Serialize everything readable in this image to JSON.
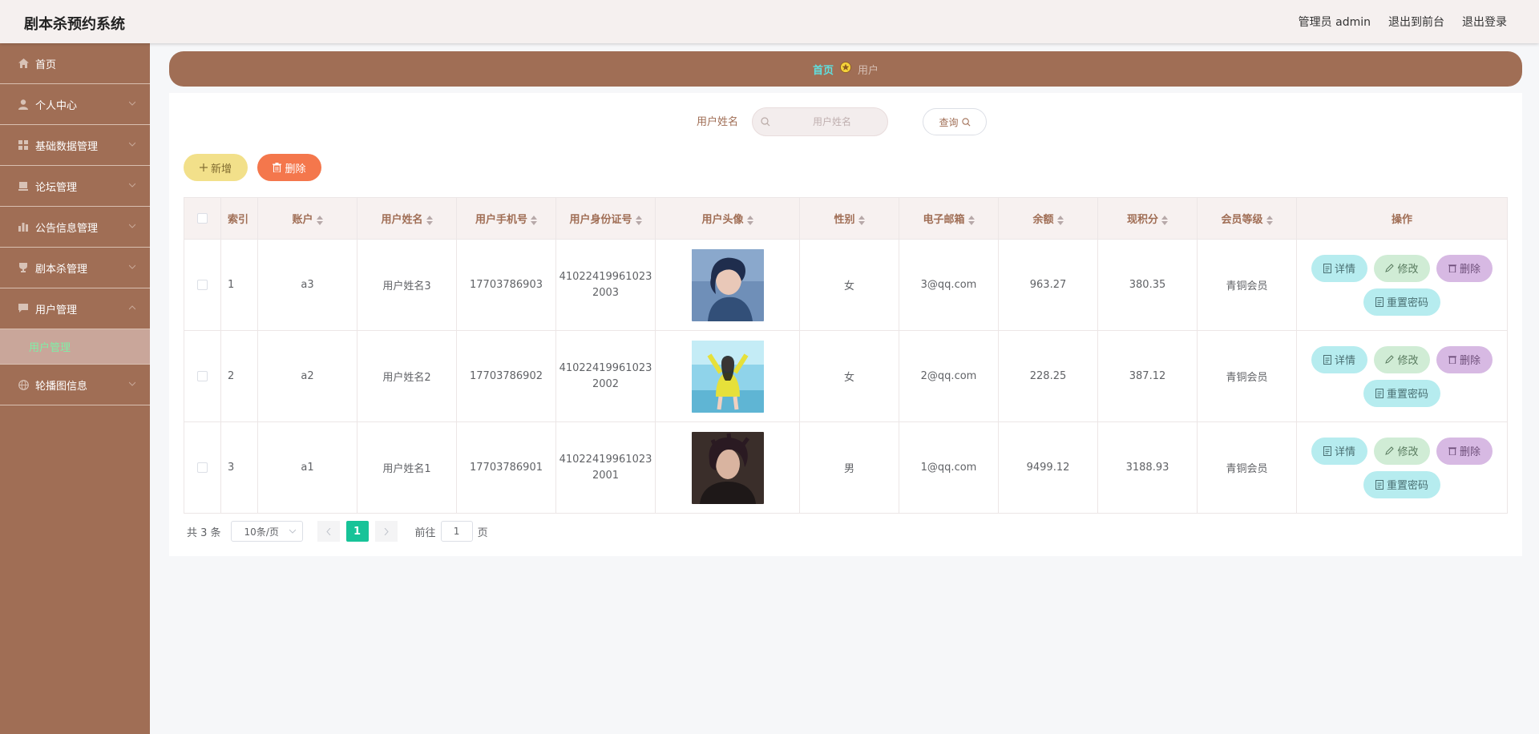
{
  "app": {
    "title": "剧本杀预约系统"
  },
  "topnav": {
    "admin": "管理员 admin",
    "front": "退出到前台",
    "logout": "退出登录"
  },
  "sidebar": {
    "items": [
      {
        "label": "首页",
        "icon": "home-icon"
      },
      {
        "label": "个人中心",
        "icon": "user-icon"
      },
      {
        "label": "基础数据管理",
        "icon": "grid-icon"
      },
      {
        "label": "论坛管理",
        "icon": "forum-icon"
      },
      {
        "label": "公告信息管理",
        "icon": "chart-icon"
      },
      {
        "label": "剧本杀管理",
        "icon": "trophy-icon"
      },
      {
        "label": "用户管理",
        "icon": "chat-icon"
      },
      {
        "label": "轮播图信息",
        "icon": "globe-icon"
      }
    ],
    "active_sub": "用户管理"
  },
  "breadcrumb": {
    "home": "首页",
    "current": "用户"
  },
  "search": {
    "label": "用户姓名",
    "placeholder": "用户姓名",
    "query_label": "查询"
  },
  "actions": {
    "add_label": "新增",
    "delete_label": "删除"
  },
  "table": {
    "headers": [
      "索引",
      "账户",
      "用户姓名",
      "用户手机号",
      "用户身份证号",
      "用户头像",
      "性别",
      "电子邮箱",
      "余额",
      "现积分",
      "会员等级",
      "操作"
    ],
    "rows": [
      {
        "index": "1",
        "account": "a3",
        "name": "用户姓名3",
        "phone": "17703786903",
        "id_line1": "41022419961023",
        "id_line2": "2003",
        "gender": "女",
        "email": "3@qq.com",
        "balance": "963.27",
        "points": "380.35",
        "level": "青铜会员"
      },
      {
        "index": "2",
        "account": "a2",
        "name": "用户姓名2",
        "phone": "17703786902",
        "id_line1": "41022419961023",
        "id_line2": "2002",
        "gender": "女",
        "email": "2@qq.com",
        "balance": "228.25",
        "points": "387.12",
        "level": "青铜会员"
      },
      {
        "index": "3",
        "account": "a1",
        "name": "用户姓名1",
        "phone": "17703786901",
        "id_line1": "41022419961023",
        "id_line2": "2001",
        "gender": "男",
        "email": "1@qq.com",
        "balance": "9499.12",
        "points": "3188.93",
        "level": "青铜会员"
      }
    ],
    "ops": {
      "detail": "详情",
      "edit": "修改",
      "delete": "删除",
      "reset": "重置密码"
    }
  },
  "pager": {
    "total": "共 3 条",
    "page_size": "10条/页",
    "current": "1",
    "goto_prefix": "前往",
    "goto_value": "1",
    "goto_suffix": "页"
  },
  "colors": {
    "brand": "#a06e55",
    "active_sub": "#7ef0a7",
    "page_active": "#17c398"
  }
}
